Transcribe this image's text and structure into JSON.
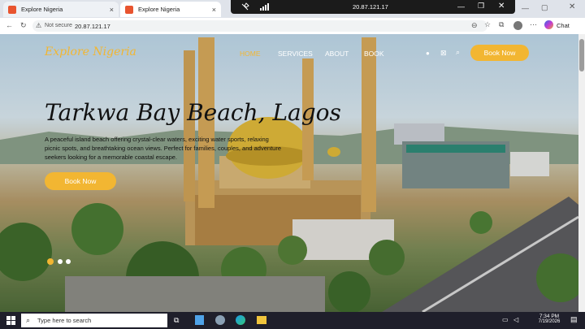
{
  "browser": {
    "tabs": [
      {
        "title": "Explore Nigeria",
        "close": "×"
      },
      {
        "title": "Explore Nigeria",
        "close": "×"
      }
    ],
    "new_tab": "+",
    "address": {
      "security": "Not secure",
      "url": "20.87.121.17"
    },
    "chat_label": "Chat"
  },
  "remote": {
    "host": "20.87.121.17"
  },
  "site": {
    "logo": "Explore Nigeria",
    "nav": [
      "HOME",
      "SERVICES",
      "ABOUT",
      "BOOK"
    ],
    "book_button": "Book Now",
    "hero": {
      "title": "Tarkwa Bay Beach, Lagos",
      "description": "A peaceful island beach offering crystal-clear waters, exciting water sports, relaxing picnic spots, and breathtaking ocean views. Perfect for families, couples, and adventure seekers looking for a memorable coastal escape.",
      "cta": "Book Now"
    },
    "carousel": {
      "count": 3,
      "active": 1
    }
  },
  "taskbar": {
    "search_placeholder": "Type here to search",
    "time": "7:34 PM",
    "date": "7/19/2026"
  },
  "colors": {
    "accent": "#f2b632",
    "nav_active": "#f2b632"
  }
}
